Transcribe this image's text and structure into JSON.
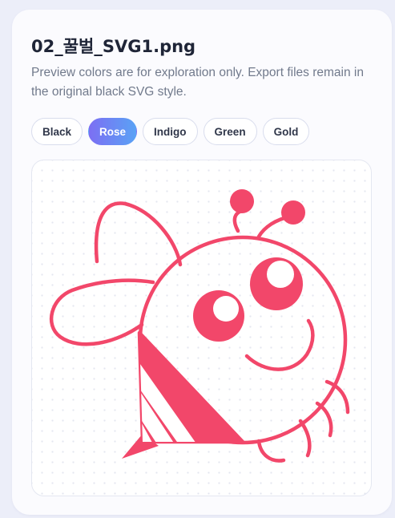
{
  "card": {
    "title": "02_꿀벌_SVG1.png",
    "description": "Preview colors are for exploration only. Export files remain in the original black SVG style."
  },
  "color_options": [
    {
      "label": "Black",
      "active": false
    },
    {
      "label": "Rose",
      "active": true
    },
    {
      "label": "Indigo",
      "active": false
    },
    {
      "label": "Green",
      "active": false
    },
    {
      "label": "Gold",
      "active": false
    }
  ],
  "preview": {
    "illustration": "bee-icon",
    "selected_color": "#f2476a"
  }
}
